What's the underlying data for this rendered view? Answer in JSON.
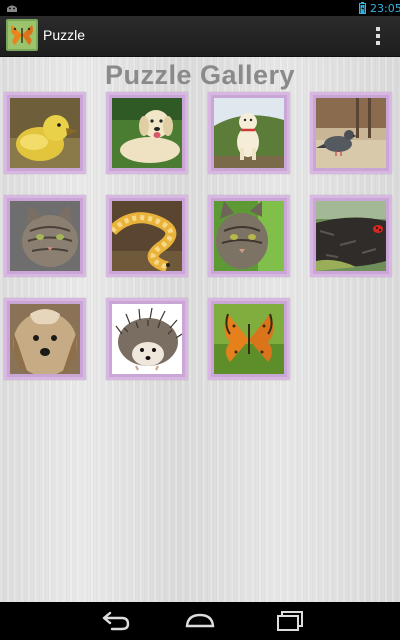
{
  "status_bar": {
    "time": "23:05",
    "icons": [
      "android-notification-icon",
      "battery-charging-icon"
    ]
  },
  "action_bar": {
    "title": "Puzzle",
    "app_icon": "butterfly-app-icon",
    "overflow_icon": "overflow-menu-icon"
  },
  "gallery": {
    "title": "Puzzle Gallery",
    "items": [
      {
        "subject": "duckling"
      },
      {
        "subject": "golden retriever"
      },
      {
        "subject": "labrador dog on hill"
      },
      {
        "subject": "pigeon"
      },
      {
        "subject": "tabby cat"
      },
      {
        "subject": "corn snake"
      },
      {
        "subject": "tabby cat in grass"
      },
      {
        "subject": "ladybug on bark"
      },
      {
        "subject": "yorkshire terrier"
      },
      {
        "subject": "hedgehog"
      },
      {
        "subject": "orange butterfly"
      }
    ]
  },
  "nav_bar": {
    "icons": [
      "back-icon",
      "home-icon",
      "recent-apps-icon"
    ]
  },
  "colors": {
    "tile_border": "#d8b8e2",
    "title_text": "#8a8a8a",
    "status_accent": "#33b5e5"
  }
}
